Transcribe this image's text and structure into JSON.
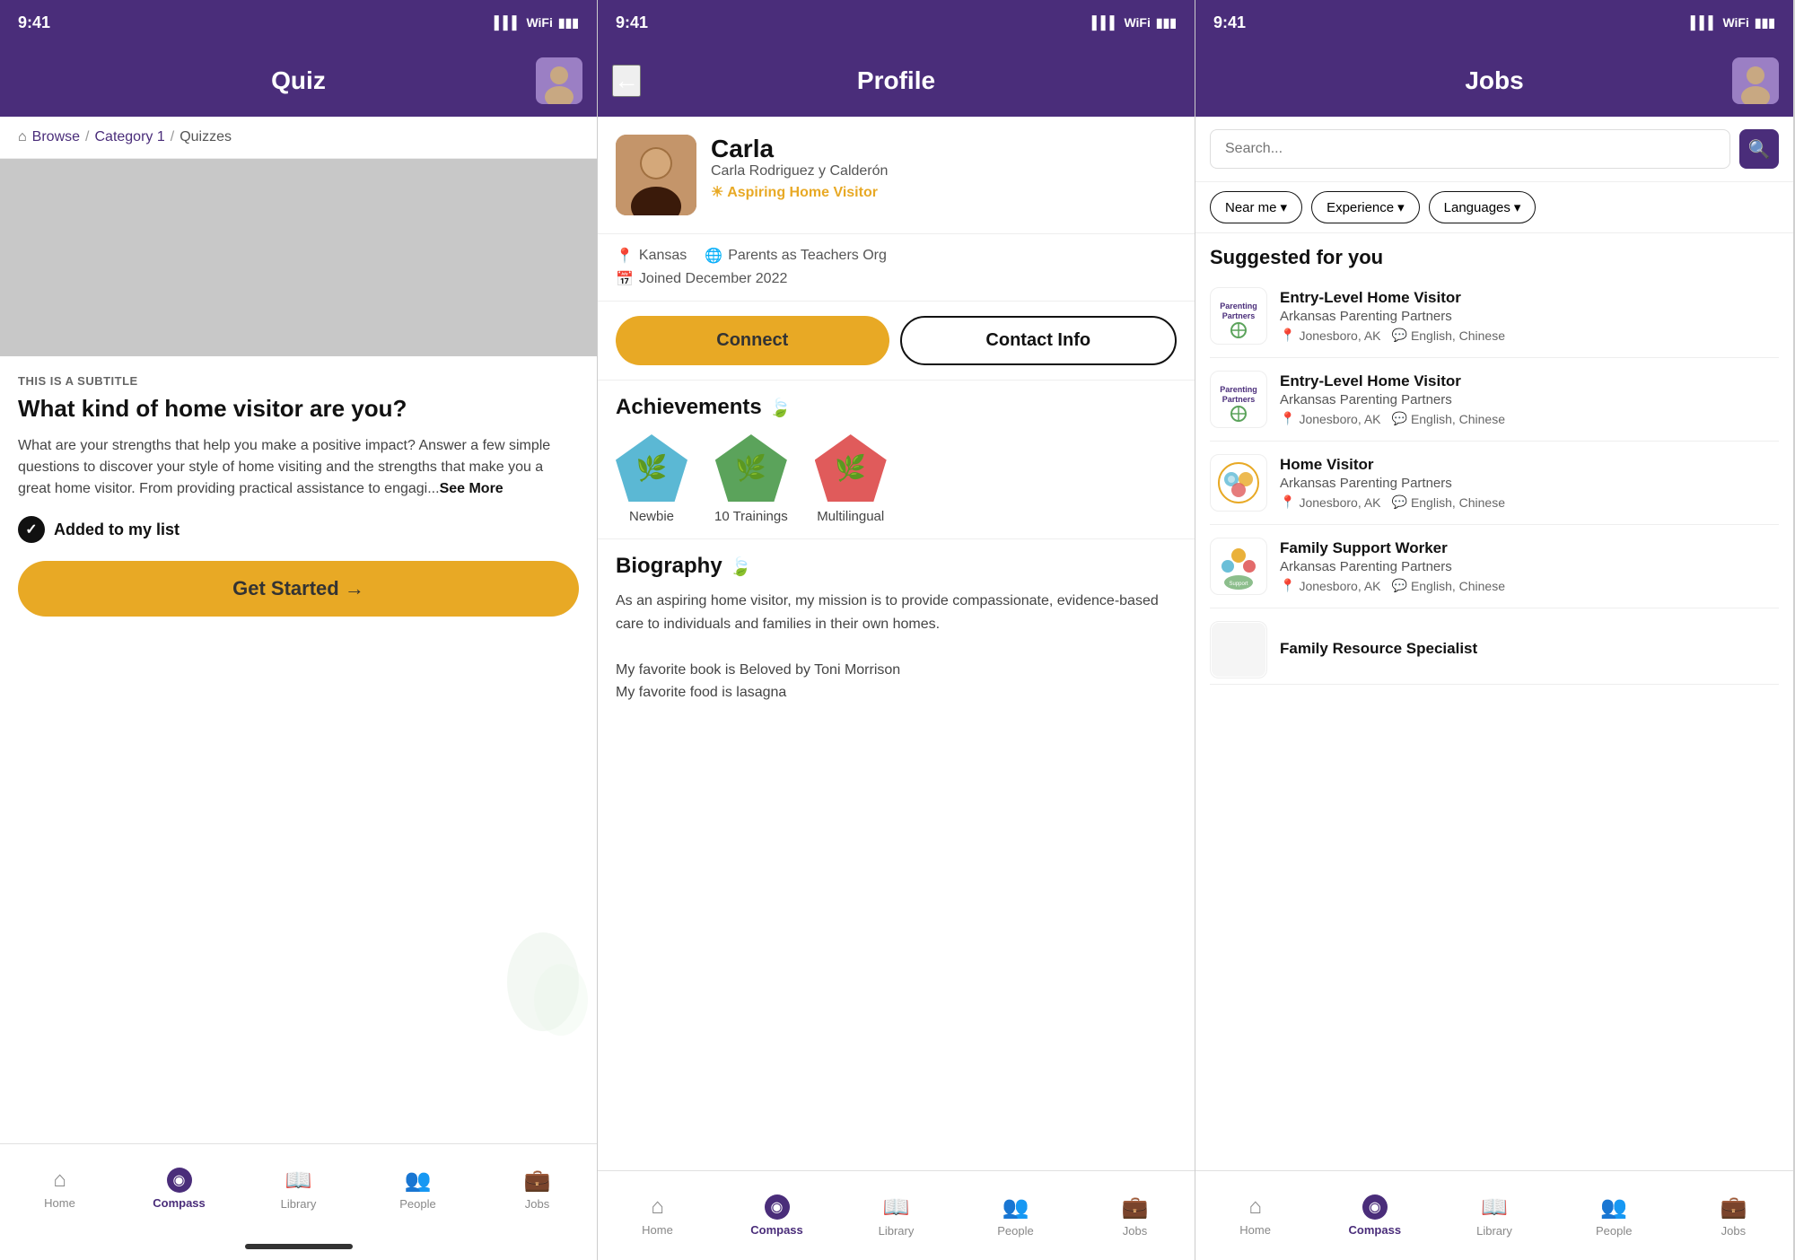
{
  "screens": [
    {
      "id": "quiz",
      "status_time": "9:41",
      "header_title": "Quiz",
      "breadcrumb": [
        "Browse",
        "Category 1",
        "Quizzes"
      ],
      "subtitle": "THIS IS A SUBTITLE",
      "title": "What kind of home visitor are you?",
      "description": "What are your strengths that help you make a positive impact? Answer a few simple questions to discover your style of home visiting and the strengths that make you a great home visitor. From providing practical assistance to engagi...",
      "see_more": "See More",
      "added_label": "Added to my list",
      "cta_label": "Get Started →",
      "nav": [
        "Home",
        "Compass",
        "Library",
        "People",
        "Jobs"
      ],
      "active_nav": 1
    },
    {
      "id": "profile",
      "status_time": "9:41",
      "header_title": "Profile",
      "user_first_name": "Carla",
      "user_full_name": "Carla Rodriguez y Calderón",
      "user_role": "Aspiring Home Visitor",
      "location": "Kansas",
      "org": "Parents as Teachers Org",
      "joined": "Joined December 2022",
      "btn_connect": "Connect",
      "btn_contact": "Contact Info",
      "achievements_title": "Achievements",
      "badges": [
        {
          "label": "Newbie",
          "color": "blue"
        },
        {
          "label": "10 Trainings",
          "color": "green"
        },
        {
          "label": "Multilingual",
          "color": "red"
        }
      ],
      "biography_title": "Biography",
      "bio_text": "As an aspiring home visitor, my mission is to provide compassionate, evidence-based care to individuals and families in their own homes.\n\nMy favorite book is Beloved by Toni Morrison\nMy favorite food is lasagna",
      "nav": [
        "Home",
        "Compass",
        "Library",
        "People",
        "Jobs"
      ],
      "active_nav": 1
    },
    {
      "id": "jobs",
      "status_time": "9:41",
      "header_title": "Jobs",
      "search_placeholder": "Search...",
      "filters": [
        "Near me",
        "Experience",
        "Languages"
      ],
      "suggested_title": "Suggested for you",
      "jobs": [
        {
          "title": "Entry-Level Home Visitor",
          "company": "Arkansas Parenting Partners",
          "location": "Jonesboro, AK",
          "languages": "English, Chinese",
          "logo_type": "parenting_partners_1"
        },
        {
          "title": "Entry-Level Home Visitor",
          "company": "Arkansas Parenting Partners",
          "location": "Jonesboro, AK",
          "languages": "English, Chinese",
          "logo_type": "parenting_partners_1"
        },
        {
          "title": "Home Visitor",
          "company": "Arkansas Parenting Partners",
          "location": "Jonesboro, AK",
          "languages": "English, Chinese",
          "logo_type": "parenting_partners_2"
        },
        {
          "title": "Family Support Worker",
          "company": "Arkansas Parenting Partners",
          "location": "Jonesboro, AK",
          "languages": "English, Chinese",
          "logo_type": "family_support"
        },
        {
          "title": "Family Resource Specialist",
          "company": "",
          "location": "",
          "languages": "",
          "logo_type": "empty"
        }
      ],
      "nav": [
        "Home",
        "Compass",
        "Library",
        "People",
        "Jobs"
      ],
      "active_nav": 1
    }
  ],
  "colors": {
    "purple": "#4a2d7a",
    "gold": "#E8A925",
    "nav_active": "#4a2d7a",
    "nav_inactive": "#888888"
  },
  "icons": {
    "home": "⌂",
    "compass": "◉",
    "library": "📖",
    "people": "👥",
    "jobs": "💼",
    "location": "📍",
    "globe": "🌐",
    "calendar": "📅",
    "check": "✓",
    "search": "🔍",
    "back": "←",
    "dropdown": "▾",
    "speech": "💬",
    "leaf": "🍃",
    "sun": "☀"
  }
}
